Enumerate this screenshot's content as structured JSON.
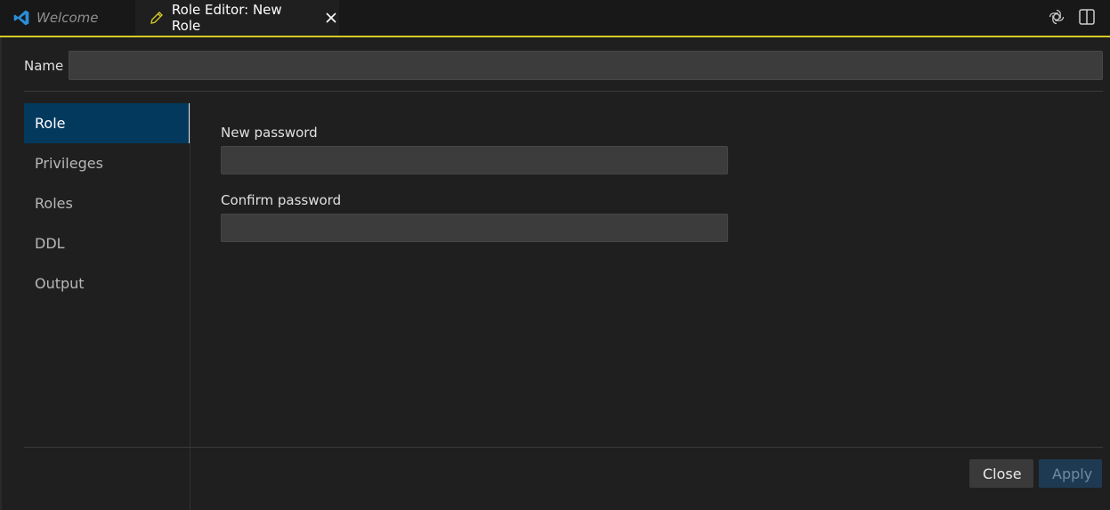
{
  "tabs": [
    {
      "label": "Welcome",
      "icon": "vscode-logo-icon"
    },
    {
      "label": "Role Editor: New Role",
      "icon": "pencil-icon"
    }
  ],
  "colors": {
    "accent": "#d7c926",
    "active_nav": "#04395e",
    "apply": "#1e3a52"
  },
  "form": {
    "name_label": "Name",
    "name_value": ""
  },
  "sidebar": {
    "items": [
      {
        "label": "Role",
        "active": true
      },
      {
        "label": "Privileges",
        "active": false
      },
      {
        "label": "Roles",
        "active": false
      },
      {
        "label": "DDL",
        "active": false
      },
      {
        "label": "Output",
        "active": false
      }
    ]
  },
  "role": {
    "new_password_label": "New password",
    "new_password_value": "",
    "confirm_password_label": "Confirm password",
    "confirm_password_value": ""
  },
  "footer": {
    "close_label": "Close",
    "apply_label": "Apply"
  }
}
